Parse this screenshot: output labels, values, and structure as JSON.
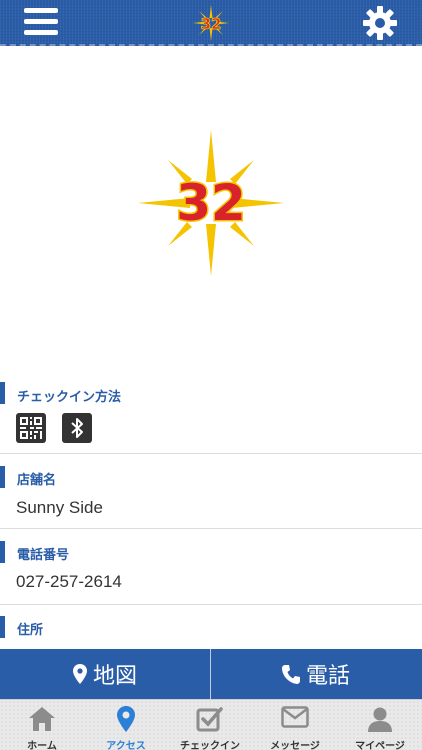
{
  "header": {
    "menu_icon": "hamburger-menu-icon",
    "logo_text": "32",
    "settings_icon": "gear-icon"
  },
  "hero": {
    "logo_text": "32"
  },
  "sections": {
    "checkin": {
      "title": "チェックイン方法",
      "methods": [
        "qr-code-icon",
        "bluetooth-icon"
      ]
    },
    "store": {
      "title": "店舗名",
      "value": "Sunny Side"
    },
    "phone": {
      "title": "電話番号",
      "value": "027-257-2614"
    },
    "address": {
      "title": "住所"
    }
  },
  "actions": {
    "map_label": "地図",
    "call_label": "電話"
  },
  "tabs": [
    {
      "label": "ホーム",
      "icon": "home-icon"
    },
    {
      "label": "アクセス",
      "icon": "location-pin-icon",
      "active": true
    },
    {
      "label": "チェックイン",
      "icon": "checkbox-icon"
    },
    {
      "label": "メッセージ",
      "icon": "envelope-icon"
    },
    {
      "label": "マイページ",
      "icon": "user-icon"
    }
  ],
  "colors": {
    "primary": "#2a5da8",
    "accent": "#2a7fd6",
    "logo_red": "#d9232a",
    "logo_yellow": "#f4c400"
  }
}
